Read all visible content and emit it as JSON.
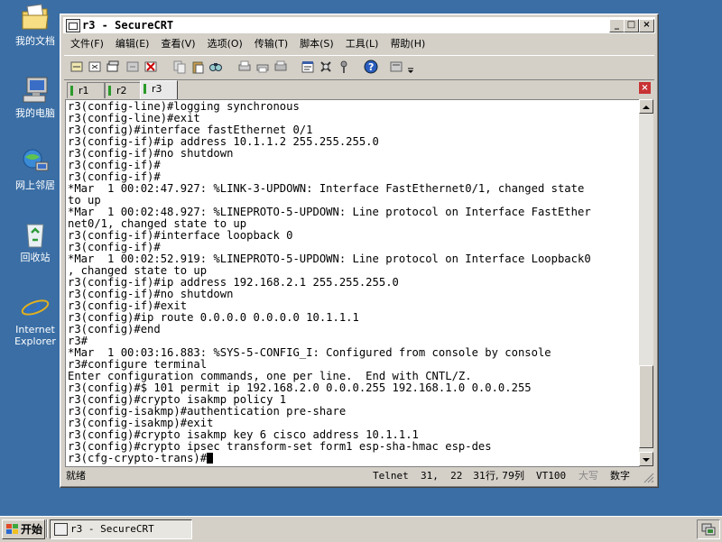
{
  "desktop": {
    "icons": [
      {
        "label": "我的文档",
        "icon": "my-documents-folder"
      },
      {
        "label": "我的电脑",
        "icon": "my-computer"
      },
      {
        "label": "网上邻居",
        "icon": "network-places"
      },
      {
        "label": "回收站",
        "icon": "recycle-bin"
      },
      {
        "label": "Internet Explorer",
        "icon": "internet-explorer"
      }
    ]
  },
  "window": {
    "title": "r3 - SecureCRT",
    "menu": [
      "文件(F)",
      "编辑(E)",
      "查看(V)",
      "选项(O)",
      "传输(T)",
      "脚本(S)",
      "工具(L)",
      "帮助(H)"
    ],
    "tabs": [
      {
        "label": "r1",
        "active": false
      },
      {
        "label": "r2",
        "active": false
      },
      {
        "label": "r3",
        "active": true
      }
    ],
    "terminal_lines": [
      "r3(config-line)#logging synchronous",
      "r3(config-line)#exit",
      "r3(config)#interface fastEthernet 0/1",
      "r3(config-if)#ip address 10.1.1.2 255.255.255.0",
      "r3(config-if)#no shutdown",
      "r3(config-if)#",
      "r3(config-if)#",
      "*Mar  1 00:02:47.927: %LINK-3-UPDOWN: Interface FastEthernet0/1, changed state",
      "to up",
      "*Mar  1 00:02:48.927: %LINEPROTO-5-UPDOWN: Line protocol on Interface FastEther",
      "net0/1, changed state to up",
      "r3(config-if)#interface loopback 0",
      "r3(config-if)#",
      "*Mar  1 00:02:52.919: %LINEPROTO-5-UPDOWN: Line protocol on Interface Loopback0",
      ", changed state to up",
      "r3(config-if)#ip address 192.168.2.1 255.255.255.0",
      "r3(config-if)#no shutdown",
      "r3(config-if)#exit",
      "r3(config)#ip route 0.0.0.0 0.0.0.0 10.1.1.1",
      "r3(config)#end",
      "r3#",
      "*Mar  1 00:03:16.883: %SYS-5-CONFIG_I: Configured from console by console",
      "r3#configure terminal",
      "Enter configuration commands, one per line.  End with CNTL/Z.",
      "r3(config)#$ 101 permit ip 192.168.2.0 0.0.0.255 192.168.1.0 0.0.0.255",
      "r3(config)#crypto isakmp policy 1",
      "r3(config-isakmp)#authentication pre-share",
      "r3(config-isakmp)#exit",
      "r3(config)#crypto isakmp key 6 cisco address 10.1.1.1",
      "r3(config)#crypto ipsec transform-set form1 esp-sha-hmac esp-des",
      "r3(cfg-crypto-trans)#"
    ],
    "status": {
      "ready": "就绪",
      "protocol": "Telnet",
      "cursor_pos": "31,  22",
      "rowcol": "31行, 79列",
      "terminal_type": "VT100",
      "caps": "大写",
      "num": "数字"
    }
  },
  "taskbar": {
    "start_label": "开始",
    "task_label": "r3 - SecureCRT"
  }
}
